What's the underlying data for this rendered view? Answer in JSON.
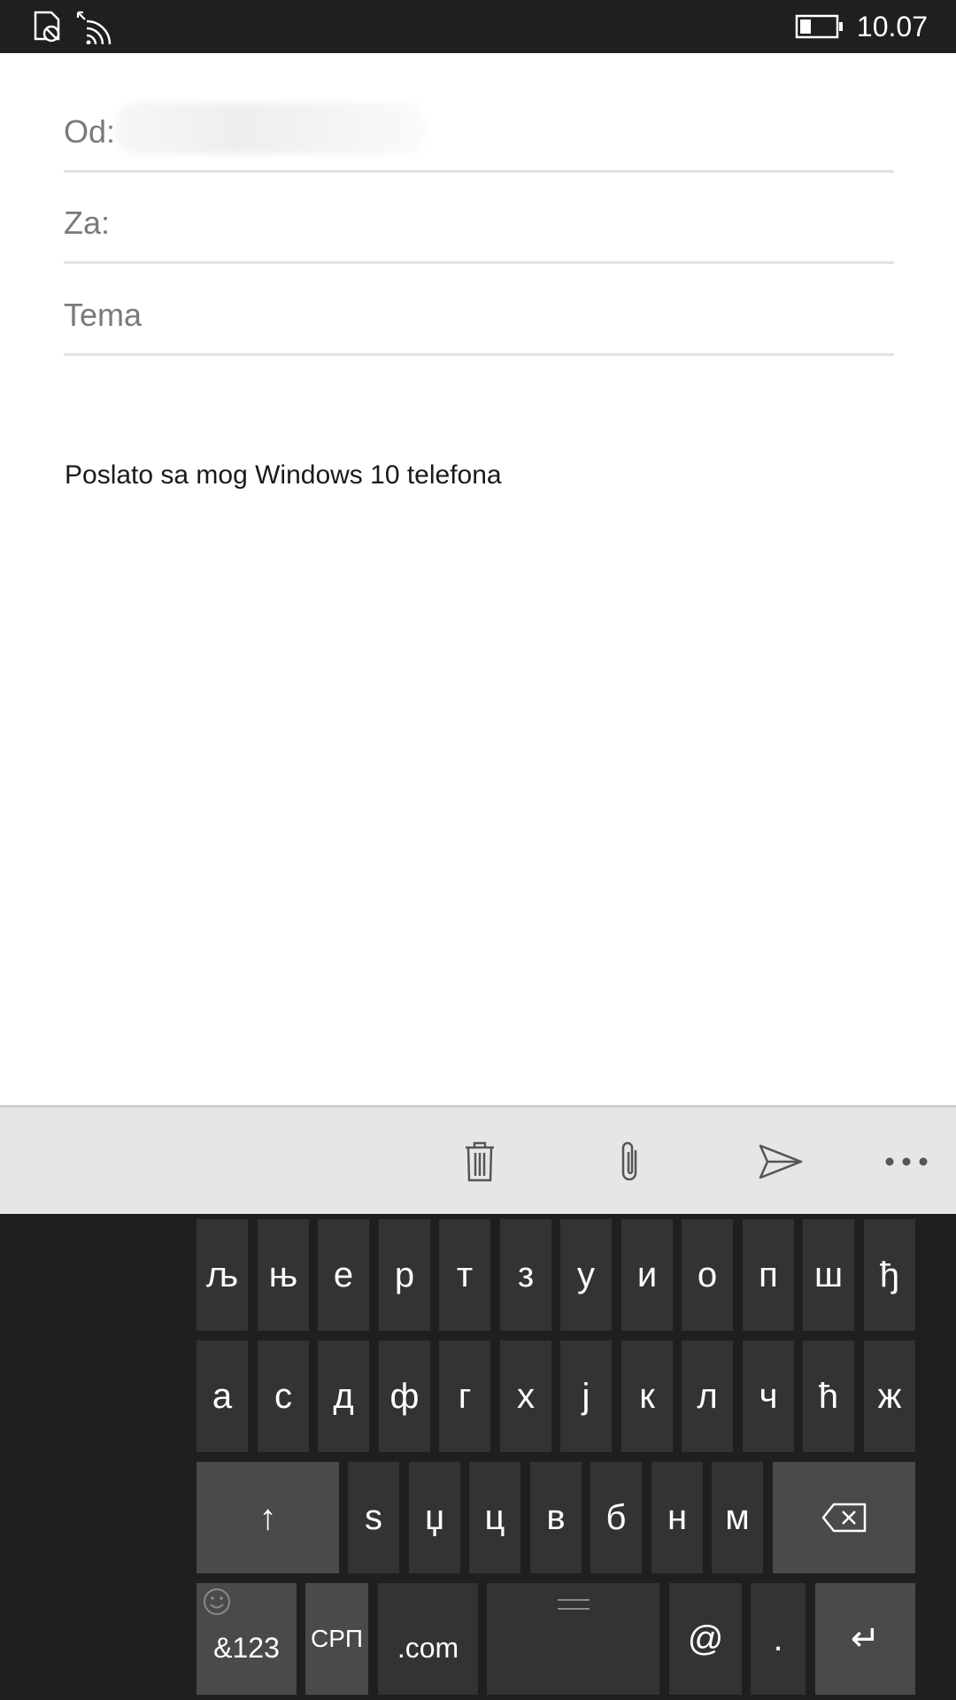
{
  "status_bar": {
    "time": "10.07",
    "icons": [
      "no-sim-icon",
      "wifi-icon",
      "battery-icon"
    ]
  },
  "compose": {
    "from_label": "Od:",
    "to_label": "Za:",
    "subject_placeholder": "Tema",
    "body": "Poslato sa mog Windows 10 telefona"
  },
  "command_bar": {
    "icons": [
      "trash-icon",
      "paperclip-icon",
      "send-icon",
      "more-icon"
    ]
  },
  "keyboard": {
    "row1": [
      "љ",
      "њ",
      "е",
      "р",
      "т",
      "з",
      "у",
      "и",
      "о",
      "п",
      "ш",
      "ђ"
    ],
    "row2": [
      "а",
      "с",
      "д",
      "ф",
      "г",
      "х",
      "ј",
      "к",
      "л",
      "ч",
      "ћ",
      "ж"
    ],
    "row3": [
      "s",
      "џ",
      "ц",
      "в",
      "б",
      "н",
      "м"
    ],
    "shift": "↑",
    "symbols": "&123",
    "language": "СРП",
    "dotcom": ".com",
    "at": "@",
    "period": ".",
    "enter": "↵"
  },
  "colors": {
    "status_bar": "#1f1f1f",
    "keyboard_bg": "#1f1f1f",
    "key": "#333333",
    "key_dark": "#4a4a4a",
    "command_bar": "#e6e6e6"
  }
}
